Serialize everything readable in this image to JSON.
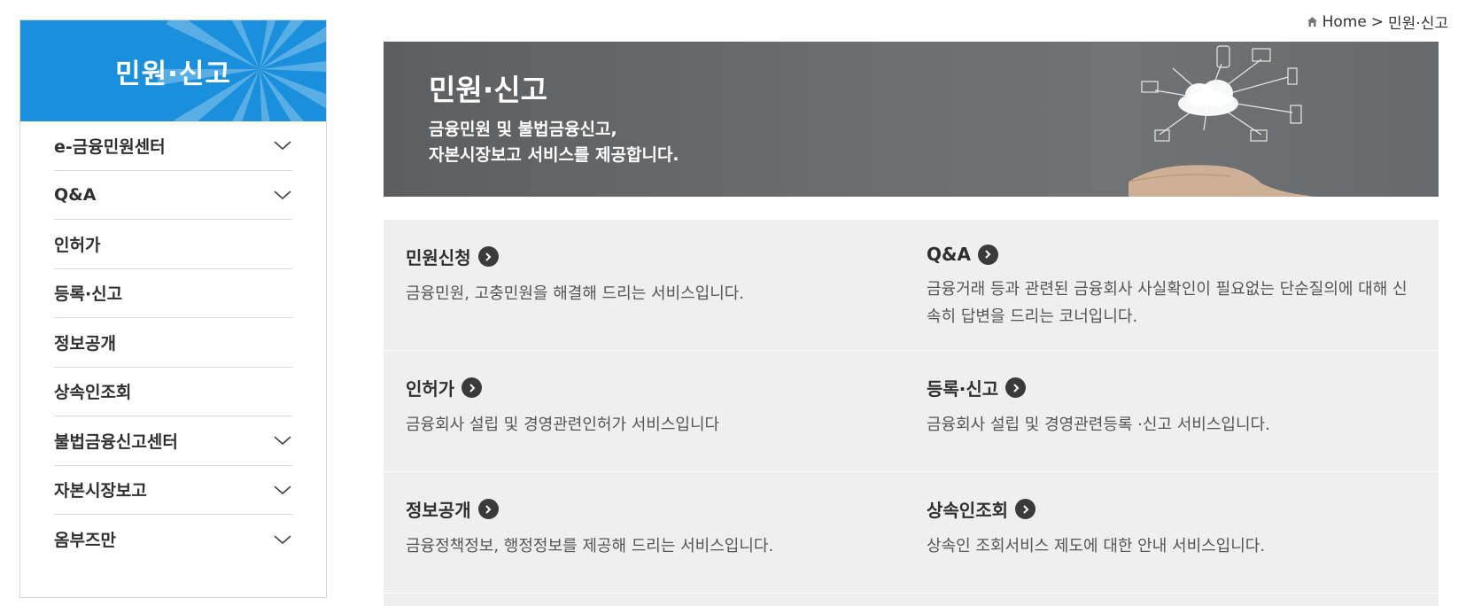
{
  "sidebar": {
    "title": "민원·신고",
    "items": [
      {
        "label": "e-금융민원센터",
        "expandable": true
      },
      {
        "label": "Q&A",
        "expandable": true
      },
      {
        "label": "인허가",
        "expandable": false
      },
      {
        "label": "등록·신고",
        "expandable": false
      },
      {
        "label": "정보공개",
        "expandable": false
      },
      {
        "label": "상속인조회",
        "expandable": false
      },
      {
        "label": "불법금융신고센터",
        "expandable": true
      },
      {
        "label": "자본시장보고",
        "expandable": true
      },
      {
        "label": "옴부즈만",
        "expandable": true
      }
    ]
  },
  "breadcrumb": {
    "home": "Home",
    "separator": ">",
    "current": "민원·신고"
  },
  "banner": {
    "title": "민원·신고",
    "line1": "금융민원 및 불법금융신고,",
    "line2": "자본시장보고 서비스를 제공합니다."
  },
  "services": [
    {
      "title": "민원신청",
      "desc": "금융민원, 고충민원을 해결해 드리는 서비스입니다."
    },
    {
      "title": "Q&A",
      "desc": "금융거래 등과 관련된 금융회사 사실확인이 필요없는 단순질의에 대해 신속히 답변을 드리는 코너입니다."
    },
    {
      "title": "인허가",
      "desc": "금융회사 설립 및 경영관련인허가 서비스입니다"
    },
    {
      "title": "등록·신고",
      "desc": "금융회사 설립 및 경영관련등록 ·신고 서비스입니다."
    },
    {
      "title": "정보공개",
      "desc": "금융정책정보, 행정정보를 제공해 드리는 서비스입니다."
    },
    {
      "title": "상속인조회",
      "desc": "상속인 조회서비스 제도에 대한 안내 서비스입니다."
    }
  ],
  "colors": {
    "accent": "#1a8fdb",
    "banner": "#6b6d6f",
    "grid_bg": "#efefef"
  }
}
